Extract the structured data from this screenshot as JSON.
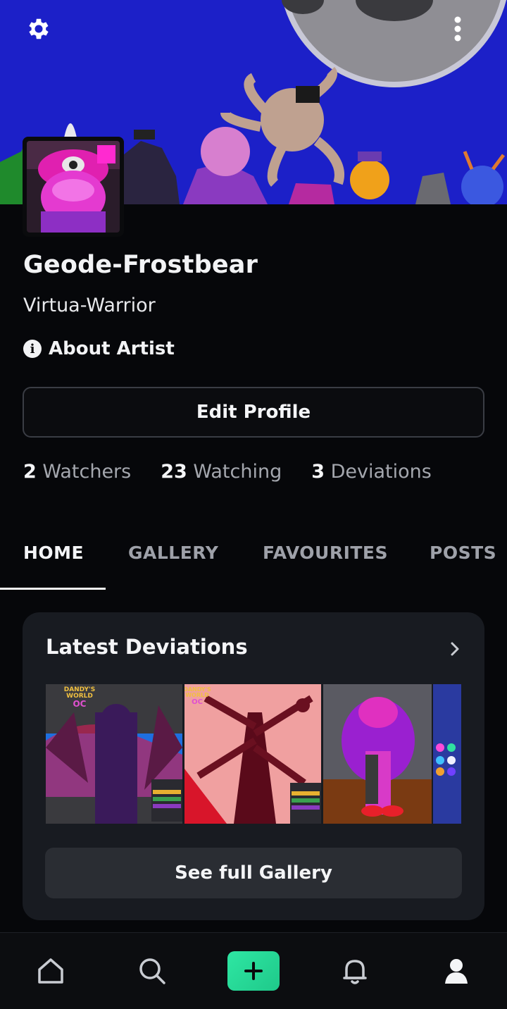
{
  "profile": {
    "username": "Geode-Frostbear",
    "tagline": "Virtua-Warrior",
    "about_label": "About Artist",
    "edit_label": "Edit Profile"
  },
  "stats": [
    {
      "num": "2",
      "label": "Watchers"
    },
    {
      "num": "23",
      "label": "Watching"
    },
    {
      "num": "3",
      "label": "Deviations"
    }
  ],
  "tabs": [
    "HOME",
    "GALLERY",
    "FAVOURITES",
    "POSTS"
  ],
  "active_tab": "HOME",
  "latest": {
    "title": "Latest Deviations",
    "button": "See full Gallery"
  },
  "thumb_text": {
    "t1": {
      "brand": "DANDY'S",
      "brand2": "WORLD",
      "oc": "OC"
    },
    "t2": {
      "brand": "DANDY'S",
      "brand2": "WORLD",
      "oc": "OC"
    }
  },
  "icons": {
    "settings": "gear-icon",
    "more": "more-vertical-icon",
    "info": "info-icon",
    "chevron": "chevron-right-icon",
    "nav": [
      "home-icon",
      "search-icon",
      "plus-icon",
      "bell-icon",
      "user-icon"
    ]
  },
  "colors": {
    "accent": "#2ee7a3",
    "background": "#06070a",
    "card": "#181b21"
  }
}
